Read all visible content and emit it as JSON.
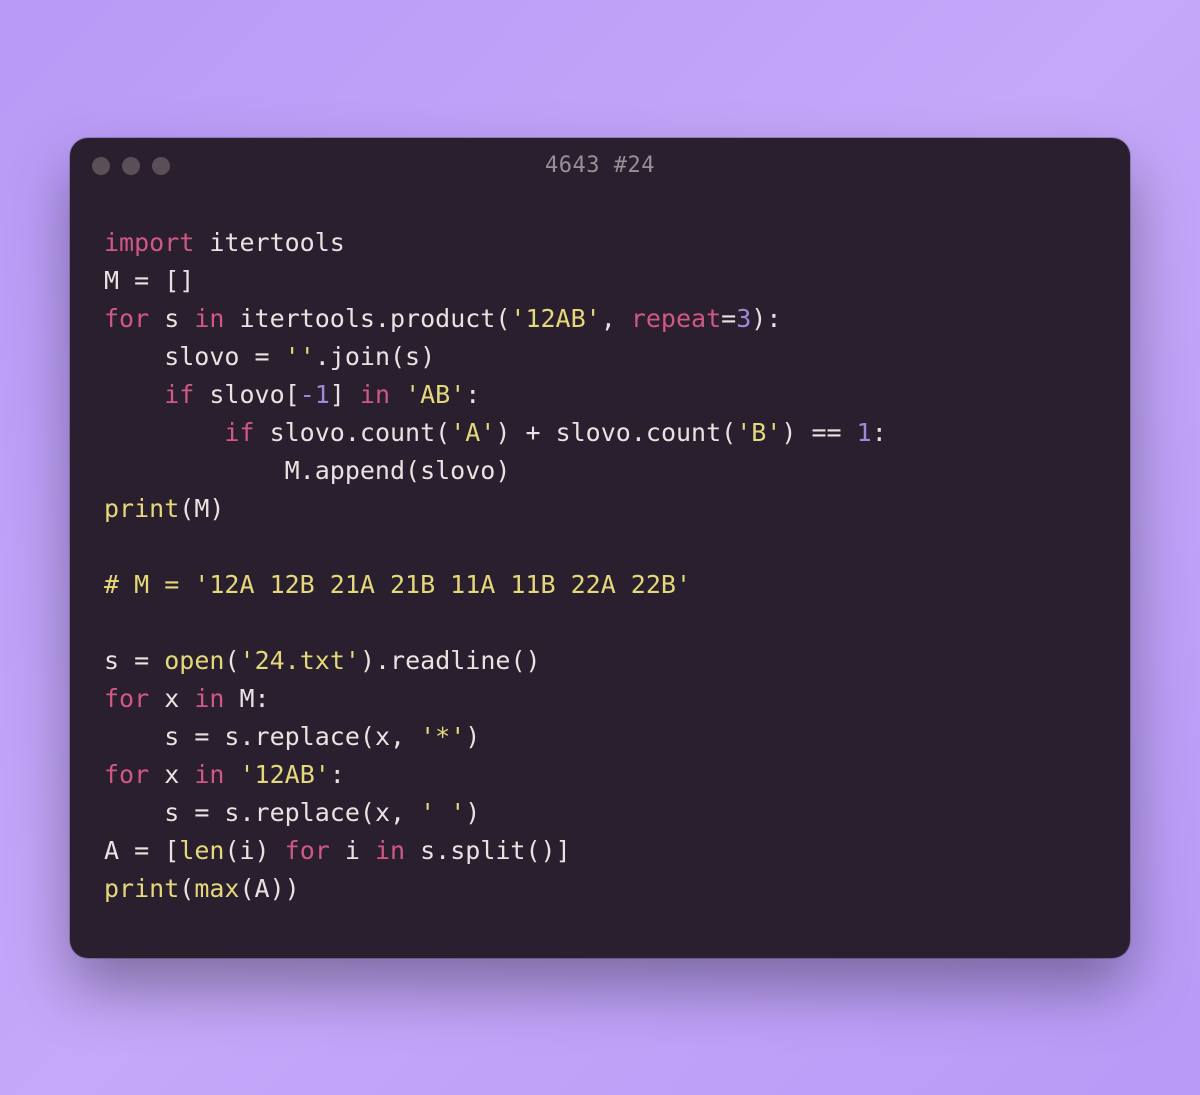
{
  "window": {
    "title": "4643 #24"
  },
  "code": {
    "lines": [
      [
        {
          "cls": "kw",
          "t": "import"
        },
        {
          "cls": "fn",
          "t": " itertools"
        }
      ],
      [
        {
          "cls": "fn",
          "t": "M "
        },
        {
          "cls": "op",
          "t": "="
        },
        {
          "cls": "fn",
          "t": " []"
        }
      ],
      [
        {
          "cls": "kw",
          "t": "for"
        },
        {
          "cls": "fn",
          "t": " s "
        },
        {
          "cls": "kw",
          "t": "in"
        },
        {
          "cls": "fn",
          "t": " itertools.product("
        },
        {
          "cls": "str",
          "t": "'12AB'"
        },
        {
          "cls": "fn",
          "t": ", "
        },
        {
          "cls": "kwarg",
          "t": "repeat"
        },
        {
          "cls": "op",
          "t": "="
        },
        {
          "cls": "num",
          "t": "3"
        },
        {
          "cls": "fn",
          "t": "):"
        }
      ],
      [
        {
          "cls": "fn",
          "t": "    slovo "
        },
        {
          "cls": "op",
          "t": "="
        },
        {
          "cls": "fn",
          "t": " "
        },
        {
          "cls": "str",
          "t": "''"
        },
        {
          "cls": "fn",
          "t": ".join(s)"
        }
      ],
      [
        {
          "cls": "fn",
          "t": "    "
        },
        {
          "cls": "kw",
          "t": "if"
        },
        {
          "cls": "fn",
          "t": " slovo["
        },
        {
          "cls": "num",
          "t": "-1"
        },
        {
          "cls": "fn",
          "t": "] "
        },
        {
          "cls": "kw",
          "t": "in"
        },
        {
          "cls": "fn",
          "t": " "
        },
        {
          "cls": "str",
          "t": "'AB'"
        },
        {
          "cls": "fn",
          "t": ":"
        }
      ],
      [
        {
          "cls": "fn",
          "t": "        "
        },
        {
          "cls": "kw",
          "t": "if"
        },
        {
          "cls": "fn",
          "t": " slovo.count("
        },
        {
          "cls": "str",
          "t": "'A'"
        },
        {
          "cls": "fn",
          "t": ") "
        },
        {
          "cls": "op",
          "t": "+"
        },
        {
          "cls": "fn",
          "t": " slovo.count("
        },
        {
          "cls": "str",
          "t": "'B'"
        },
        {
          "cls": "fn",
          "t": ") "
        },
        {
          "cls": "op",
          "t": "=="
        },
        {
          "cls": "fn",
          "t": " "
        },
        {
          "cls": "num",
          "t": "1"
        },
        {
          "cls": "fn",
          "t": ":"
        }
      ],
      [
        {
          "cls": "fn",
          "t": "            M.append(slovo)"
        }
      ],
      [
        {
          "cls": "builtin",
          "t": "print"
        },
        {
          "cls": "fn",
          "t": "(M)"
        }
      ],
      [
        {
          "cls": "fn",
          "t": ""
        }
      ],
      [
        {
          "cls": "comment",
          "t": "# M = '12A 12B 21A 21B 11A 11B 22A 22B'"
        }
      ],
      [
        {
          "cls": "fn",
          "t": ""
        }
      ],
      [
        {
          "cls": "fn",
          "t": "s "
        },
        {
          "cls": "op",
          "t": "="
        },
        {
          "cls": "fn",
          "t": " "
        },
        {
          "cls": "builtin",
          "t": "open"
        },
        {
          "cls": "fn",
          "t": "("
        },
        {
          "cls": "str",
          "t": "'24.txt'"
        },
        {
          "cls": "fn",
          "t": ").readline()"
        }
      ],
      [
        {
          "cls": "kw",
          "t": "for"
        },
        {
          "cls": "fn",
          "t": " x "
        },
        {
          "cls": "kw",
          "t": "in"
        },
        {
          "cls": "fn",
          "t": " M:"
        }
      ],
      [
        {
          "cls": "fn",
          "t": "    s "
        },
        {
          "cls": "op",
          "t": "="
        },
        {
          "cls": "fn",
          "t": " s.replace(x, "
        },
        {
          "cls": "str",
          "t": "'*'"
        },
        {
          "cls": "fn",
          "t": ")"
        }
      ],
      [
        {
          "cls": "kw",
          "t": "for"
        },
        {
          "cls": "fn",
          "t": " x "
        },
        {
          "cls": "kw",
          "t": "in"
        },
        {
          "cls": "fn",
          "t": " "
        },
        {
          "cls": "str",
          "t": "'12AB'"
        },
        {
          "cls": "fn",
          "t": ":"
        }
      ],
      [
        {
          "cls": "fn",
          "t": "    s "
        },
        {
          "cls": "op",
          "t": "="
        },
        {
          "cls": "fn",
          "t": " s.replace(x, "
        },
        {
          "cls": "str",
          "t": "' '"
        },
        {
          "cls": "fn",
          "t": ")"
        }
      ],
      [
        {
          "cls": "fn",
          "t": "A "
        },
        {
          "cls": "op",
          "t": "="
        },
        {
          "cls": "fn",
          "t": " ["
        },
        {
          "cls": "builtin",
          "t": "len"
        },
        {
          "cls": "fn",
          "t": "(i) "
        },
        {
          "cls": "kw",
          "t": "for"
        },
        {
          "cls": "fn",
          "t": " i "
        },
        {
          "cls": "kw",
          "t": "in"
        },
        {
          "cls": "fn",
          "t": " s.split()]"
        }
      ],
      [
        {
          "cls": "builtin",
          "t": "print"
        },
        {
          "cls": "fn",
          "t": "("
        },
        {
          "cls": "builtin",
          "t": "max"
        },
        {
          "cls": "fn",
          "t": "(A))"
        }
      ]
    ]
  }
}
